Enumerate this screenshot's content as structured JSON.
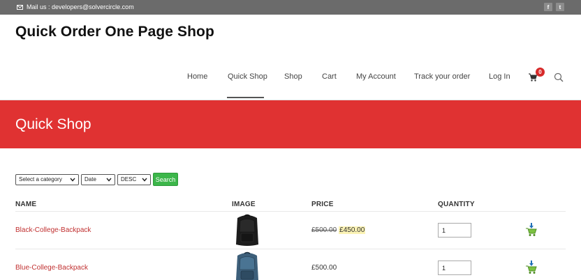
{
  "topbar": {
    "mail_label": "Mail us : developers@solvercircle.com",
    "social": [
      "f",
      "t"
    ]
  },
  "site": {
    "title": "Quick Order One Page Shop"
  },
  "nav": {
    "items": [
      "Home",
      "Quick Shop",
      "Shop",
      "Cart",
      "My Account",
      "Track your order",
      "Log In"
    ],
    "active": "Quick Shop",
    "cart_count": "0"
  },
  "banner": {
    "title": "Quick Shop"
  },
  "filters": {
    "category": "Select a category",
    "sort_by": "Date",
    "order": "DESC",
    "search_label": "Search"
  },
  "table": {
    "headers": [
      "NAME",
      "IMAGE",
      "PRICE",
      "QUANTITY"
    ],
    "rows": [
      {
        "name": "Black-College-Backpack",
        "old_price": "£500.00",
        "price": "£450.00",
        "qty": "1"
      },
      {
        "name": "Blue-College-Backpack",
        "old_price": "",
        "price": "£500.00",
        "qty": "1"
      }
    ]
  },
  "colors": {
    "banner": "#e03232",
    "search_button": "#3cb64a",
    "topbar": "#6b6b6b",
    "badge": "#d72a2a"
  }
}
